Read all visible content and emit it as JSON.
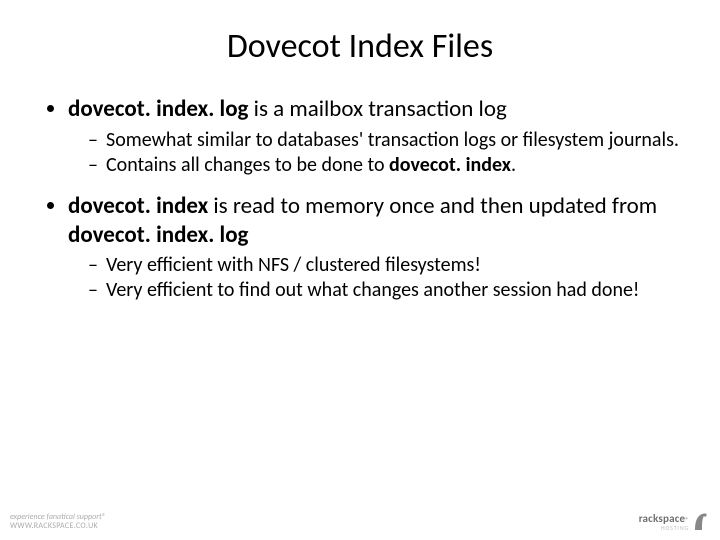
{
  "title": "Dovecot Index Files",
  "bullets": {
    "b1_bold": "dovecot. index. log",
    "b1_rest": " is a mailbox transaction log",
    "b1_sub1": "Somewhat similar to databases' transaction logs or filesystem journals.",
    "b1_sub2_a": "Contains all changes to be done to ",
    "b1_sub2_b": "dovecot. index",
    "b1_sub2_c": ".",
    "b2_a": "dovecot. index",
    "b2_b": " is read to memory once and then updated from ",
    "b2_c": "dovecot. index. log",
    "b2_sub1": "Very efficient with NFS / clustered filesystems!",
    "b2_sub2": "Very efficient to find out what changes another session had done!"
  },
  "footer": {
    "tagline": "experience fanatical support®",
    "url": "WWW.RACKSPACE.CO.UK",
    "brand_bold": "rackspace",
    "brand_sub": "HOSTING"
  }
}
